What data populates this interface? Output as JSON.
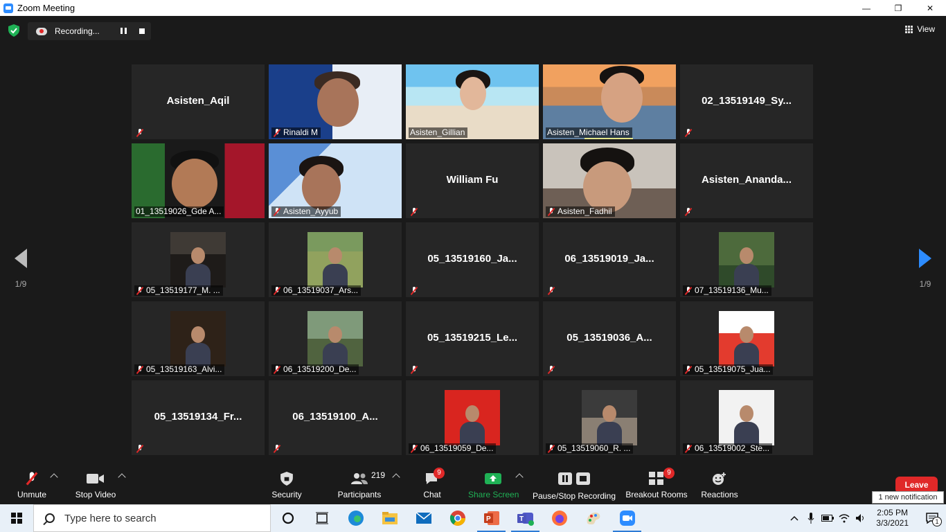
{
  "window": {
    "title": "Zoom Meeting"
  },
  "header": {
    "recording_label": "Recording...",
    "view_label": "View"
  },
  "pager": {
    "left_text": "1/9",
    "right_text": "1/9"
  },
  "colors": {
    "accent": "#2d8cff",
    "mute_red": "#e02828",
    "active_outline": "#e3e68a",
    "tile_bg": "#262626",
    "meeting_bg": "#1a1a1a"
  },
  "tiles": [
    {
      "name": "Asisten_Aqil",
      "label": "",
      "kind": "name",
      "muted": true
    },
    {
      "name": "",
      "label": "Rinaldi M",
      "kind": "video",
      "muted": true
    },
    {
      "name": "",
      "label": "Asisten_Gillian",
      "kind": "video",
      "muted": false,
      "active": true
    },
    {
      "name": "",
      "label": "Asisten_Michael Hans",
      "kind": "video",
      "muted": false
    },
    {
      "name": "02_13519149_Sy...",
      "label": "",
      "kind": "name",
      "muted": true
    },
    {
      "name": "",
      "label": "01_13519026_Gde A...",
      "kind": "video",
      "muted": false
    },
    {
      "name": "",
      "label": "Asisten_Ayyub",
      "kind": "video",
      "muted": true
    },
    {
      "name": "William Fu",
      "label": "",
      "kind": "name",
      "muted": true
    },
    {
      "name": "",
      "label": "Asisten_Fadhil",
      "kind": "video",
      "muted": true
    },
    {
      "name": "Asisten_Ananda...",
      "label": "",
      "kind": "name",
      "muted": true
    },
    {
      "name": "",
      "label": "05_13519177_M. ...",
      "kind": "thumb",
      "muted": true
    },
    {
      "name": "",
      "label": "06_13519037_Ars...",
      "kind": "thumb",
      "muted": true
    },
    {
      "name": "05_13519160_Ja...",
      "label": "",
      "kind": "name",
      "muted": true
    },
    {
      "name": "06_13519019_Ja...",
      "label": "",
      "kind": "name",
      "muted": true
    },
    {
      "name": "",
      "label": "07_13519136_Mu...",
      "kind": "thumb",
      "muted": true
    },
    {
      "name": "",
      "label": "05_13519163_Alvi...",
      "kind": "thumb",
      "muted": true
    },
    {
      "name": "",
      "label": "06_13519200_De...",
      "kind": "thumb",
      "muted": true
    },
    {
      "name": "05_13519215_Le...",
      "label": "",
      "kind": "name",
      "muted": true
    },
    {
      "name": "05_13519036_A...",
      "label": "",
      "kind": "name",
      "muted": true
    },
    {
      "name": "",
      "label": "05_13519075_Jua...",
      "kind": "thumb",
      "muted": true
    },
    {
      "name": "05_13519134_Fr...",
      "label": "",
      "kind": "name",
      "muted": true
    },
    {
      "name": "06_13519100_A...",
      "label": "",
      "kind": "name",
      "muted": true
    },
    {
      "name": "",
      "label": "06_13519059_De...",
      "kind": "thumb",
      "muted": true
    },
    {
      "name": "",
      "label": "05_13519060_R. ...",
      "kind": "thumb",
      "muted": true
    },
    {
      "name": "",
      "label": "06_13519002_Ste...",
      "kind": "thumb",
      "muted": true
    }
  ],
  "toolbar": {
    "unmute": "Unmute",
    "stop_video": "Stop Video",
    "security": "Security",
    "participants": "Participants",
    "participants_count": "219",
    "chat": "Chat",
    "chat_badge": "9",
    "share_screen": "Share Screen",
    "pause_stop_recording": "Pause/Stop Recording",
    "breakout_rooms": "Breakout Rooms",
    "breakout_badge": "9",
    "reactions": "Reactions",
    "leave": "Leave",
    "notification": "1 new notification"
  },
  "taskbar": {
    "search_placeholder": "Type here to search",
    "time": "2:05 PM",
    "date": "3/3/2021",
    "action_center_badge": "1",
    "apps": [
      "cortana-icon",
      "task-view-icon",
      "edge-icon",
      "file-explorer-icon",
      "mail-icon",
      "chrome-icon",
      "powerpoint-icon",
      "teams-icon",
      "firefox-icon",
      "paint-icon",
      "zoom-icon"
    ]
  }
}
